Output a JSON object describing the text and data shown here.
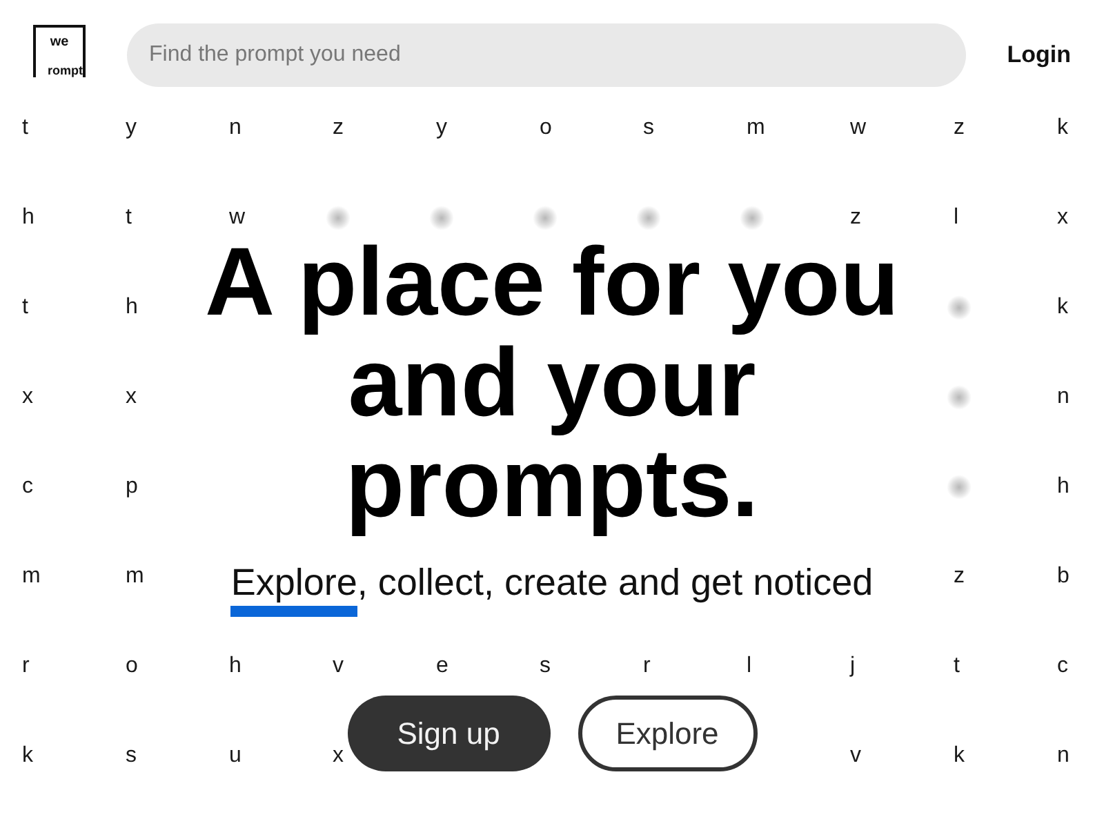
{
  "header": {
    "logo": {
      "top": "we",
      "bottom": "rompt"
    },
    "search": {
      "placeholder": "Find the prompt you need"
    },
    "login": "Login"
  },
  "letter_grid": [
    [
      {
        "kind": "letter",
        "text": "t"
      },
      {
        "kind": "letter",
        "text": "y"
      },
      {
        "kind": "letter",
        "text": "n"
      },
      {
        "kind": "letter",
        "text": "z"
      },
      {
        "kind": "letter",
        "text": "y"
      },
      {
        "kind": "letter",
        "text": "o"
      },
      {
        "kind": "letter",
        "text": "s"
      },
      {
        "kind": "letter",
        "text": "m"
      },
      {
        "kind": "letter",
        "text": "w"
      },
      {
        "kind": "letter",
        "text": "z"
      },
      {
        "kind": "letter",
        "text": "k"
      }
    ],
    [
      {
        "kind": "letter",
        "text": "h"
      },
      {
        "kind": "letter",
        "text": "t"
      },
      {
        "kind": "letter",
        "text": "w"
      },
      {
        "kind": "blurred"
      },
      {
        "kind": "blurred"
      },
      {
        "kind": "blurred"
      },
      {
        "kind": "blurred"
      },
      {
        "kind": "blurred"
      },
      {
        "kind": "letter",
        "text": "z"
      },
      {
        "kind": "letter",
        "text": "l"
      },
      {
        "kind": "letter",
        "text": "x"
      }
    ],
    [
      {
        "kind": "letter",
        "text": "t"
      },
      {
        "kind": "letter",
        "text": "h"
      },
      {
        "kind": "covered"
      },
      {
        "kind": "covered"
      },
      {
        "kind": "covered"
      },
      {
        "kind": "covered"
      },
      {
        "kind": "covered"
      },
      {
        "kind": "covered"
      },
      {
        "kind": "covered"
      },
      {
        "kind": "blurred"
      },
      {
        "kind": "letter",
        "text": "k"
      }
    ],
    [
      {
        "kind": "letter",
        "text": "x"
      },
      {
        "kind": "letter",
        "text": "x"
      },
      {
        "kind": "covered"
      },
      {
        "kind": "covered"
      },
      {
        "kind": "covered"
      },
      {
        "kind": "covered"
      },
      {
        "kind": "covered"
      },
      {
        "kind": "covered"
      },
      {
        "kind": "covered"
      },
      {
        "kind": "blurred"
      },
      {
        "kind": "letter",
        "text": "n"
      }
    ],
    [
      {
        "kind": "letter",
        "text": "c"
      },
      {
        "kind": "letter",
        "text": "p"
      },
      {
        "kind": "covered"
      },
      {
        "kind": "covered"
      },
      {
        "kind": "covered"
      },
      {
        "kind": "covered"
      },
      {
        "kind": "covered"
      },
      {
        "kind": "covered"
      },
      {
        "kind": "covered"
      },
      {
        "kind": "blurred"
      },
      {
        "kind": "letter",
        "text": "h"
      }
    ],
    [
      {
        "kind": "letter",
        "text": "m"
      },
      {
        "kind": "letter",
        "text": "m"
      },
      {
        "kind": "covered"
      },
      {
        "kind": "covered"
      },
      {
        "kind": "covered"
      },
      {
        "kind": "covered"
      },
      {
        "kind": "covered"
      },
      {
        "kind": "covered"
      },
      {
        "kind": "covered"
      },
      {
        "kind": "letter",
        "text": "z"
      },
      {
        "kind": "letter",
        "text": "b"
      }
    ],
    [
      {
        "kind": "letter",
        "text": "r"
      },
      {
        "kind": "letter",
        "text": "o"
      },
      {
        "kind": "letter",
        "text": "h"
      },
      {
        "kind": "letter",
        "text": "v"
      },
      {
        "kind": "letter",
        "text": "e"
      },
      {
        "kind": "letter",
        "text": "s"
      },
      {
        "kind": "letter",
        "text": "r"
      },
      {
        "kind": "letter",
        "text": "l"
      },
      {
        "kind": "letter",
        "text": "j"
      },
      {
        "kind": "letter",
        "text": "t"
      },
      {
        "kind": "letter",
        "text": "c"
      }
    ],
    [
      {
        "kind": "letter",
        "text": "k"
      },
      {
        "kind": "letter",
        "text": "s"
      },
      {
        "kind": "letter",
        "text": "u"
      },
      {
        "kind": "letter",
        "text": "x"
      },
      {
        "kind": "covered"
      },
      {
        "kind": "covered"
      },
      {
        "kind": "covered"
      },
      {
        "kind": "covered"
      },
      {
        "kind": "letter",
        "text": "v"
      },
      {
        "kind": "letter",
        "text": "k"
      },
      {
        "kind": "letter",
        "text": "n"
      }
    ]
  ],
  "hero": {
    "heading": "A place for you and your prompts.",
    "subtitle": [
      {
        "text": "Explore",
        "underlined": true
      },
      {
        "text": ", collect, create and get noticed",
        "underlined": false
      }
    ],
    "buttons": [
      {
        "label": "Sign up",
        "kind": "filled"
      },
      {
        "label": "Explore",
        "kind": "outlined"
      }
    ]
  }
}
